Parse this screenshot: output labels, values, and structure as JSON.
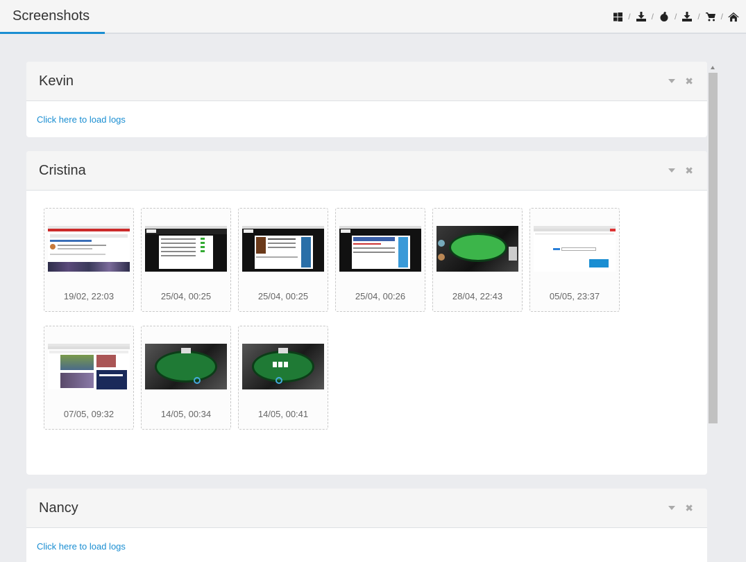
{
  "header": {
    "title": "Screenshots",
    "nav_icons": [
      "windows-icon",
      "download-icon",
      "apple-icon",
      "download-icon",
      "cart-icon",
      "home-icon"
    ],
    "separator": "/"
  },
  "panels": [
    {
      "name": "Kevin",
      "load_link": "Click here to load logs"
    },
    {
      "name": "Cristina",
      "thumbnails": [
        {
          "date": "19/02, 22:03",
          "kind": "browser-red"
        },
        {
          "date": "25/04, 00:25",
          "kind": "dark-list"
        },
        {
          "date": "25/04, 00:25",
          "kind": "dark-product"
        },
        {
          "date": "25/04, 00:26",
          "kind": "dark-form"
        },
        {
          "date": "28/04, 22:43",
          "kind": "poker"
        },
        {
          "date": "05/05, 23:37",
          "kind": "browser-blank"
        },
        {
          "date": "07/05, 09:32",
          "kind": "browser-news"
        },
        {
          "date": "14/05, 00:34",
          "kind": "poker-dark"
        },
        {
          "date": "14/05, 00:41",
          "kind": "poker-dark"
        }
      ]
    },
    {
      "name": "Nancy",
      "load_link": "Click here to load logs"
    }
  ],
  "colors": {
    "accent": "#1a8ed2",
    "felt": "#3cb54a"
  }
}
